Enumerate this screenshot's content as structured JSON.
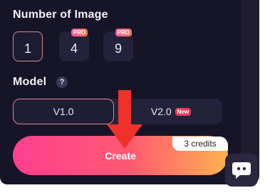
{
  "section_count": {
    "title": "Number of Image"
  },
  "count_options": [
    {
      "label": "1",
      "badge": ""
    },
    {
      "label": "4",
      "badge": "PRO"
    },
    {
      "label": "9",
      "badge": "PRO"
    }
  ],
  "selected_count": "1",
  "section_model": {
    "title": "Model",
    "help_icon": "?"
  },
  "model_options": [
    {
      "label": "V1.0",
      "badge": ""
    },
    {
      "label": "V2.0",
      "badge": "New"
    }
  ],
  "selected_model": "V1.0",
  "create": {
    "label": "Create",
    "credits": "3 credits"
  },
  "colors": {
    "panel_bg": "#161427",
    "accent_gradient_start": "#ff3f8e",
    "accent_gradient_end": "#ffb14f",
    "annotation_arrow": "#f0302a"
  },
  "icons": {
    "chat": "chat-bubble-icon",
    "annotation": "arrow-down-icon"
  }
}
